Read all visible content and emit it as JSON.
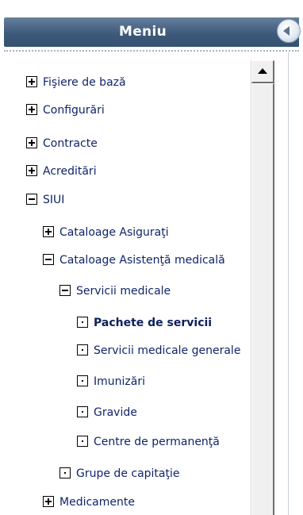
{
  "header": {
    "title": "Meniu"
  },
  "icons": {
    "collapse": "chevron-left-icon",
    "scroll_up": "triangle-up-icon",
    "expand": "plus-icon",
    "collapse_node": "minus-icon",
    "leaf": "dot-icon"
  },
  "colors": {
    "header_bg": "#3e5a7a",
    "text": "#10246b"
  },
  "tree": {
    "items": [
      {
        "label": "Fişiere de bază",
        "state": "collapsed"
      },
      {
        "label": "Configurări",
        "state": "collapsed"
      },
      {
        "label": "Contracte",
        "state": "collapsed"
      },
      {
        "label": "Acreditări",
        "state": "collapsed"
      },
      {
        "label": "SIUI",
        "state": "expanded"
      },
      {
        "label": "Cataloage Asiguraţi",
        "state": "collapsed"
      },
      {
        "label": "Cataloage Asistenţă medicală",
        "state": "expanded"
      },
      {
        "label": "Servicii medicale",
        "state": "expanded"
      },
      {
        "label": "Pachete de servicii",
        "state": "leaf",
        "selected": true
      },
      {
        "label": "Servicii medicale generale",
        "state": "leaf"
      },
      {
        "label": "Imunizări",
        "state": "leaf"
      },
      {
        "label": "Gravide",
        "state": "leaf"
      },
      {
        "label": "Centre de permanenţă",
        "state": "leaf"
      },
      {
        "label": "Grupe de capitaţie",
        "state": "leaf"
      },
      {
        "label": "Medicamente",
        "state": "collapsed"
      }
    ]
  }
}
